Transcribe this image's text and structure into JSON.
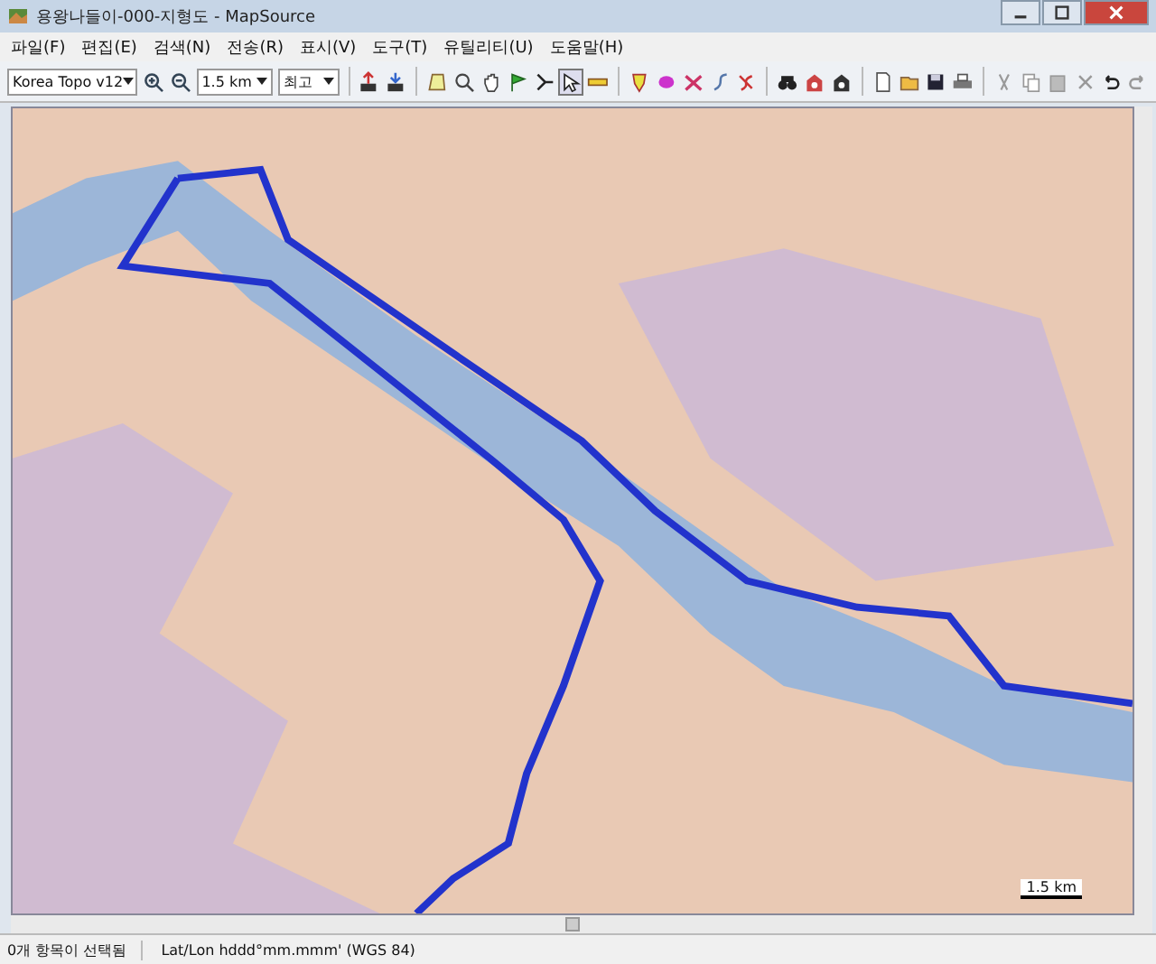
{
  "window": {
    "title": "용왕나들이-000-지형도 - MapSource"
  },
  "menu": [
    "파일(F)",
    "편집(E)",
    "검색(N)",
    "전송(R)",
    "표시(V)",
    "도구(T)",
    "유틸리티(U)",
    "도움말(H)"
  ],
  "toolbar": {
    "map_product": "Korea Topo v12",
    "zoom_scale": "1.5 km",
    "detail": "최고"
  },
  "map": {
    "scale_label": "1.5 km"
  },
  "status_bar": [
    "0개 항목이 선택됨",
    "Lat/Lon hddd°mm.mmm' (WGS 84)"
  ]
}
